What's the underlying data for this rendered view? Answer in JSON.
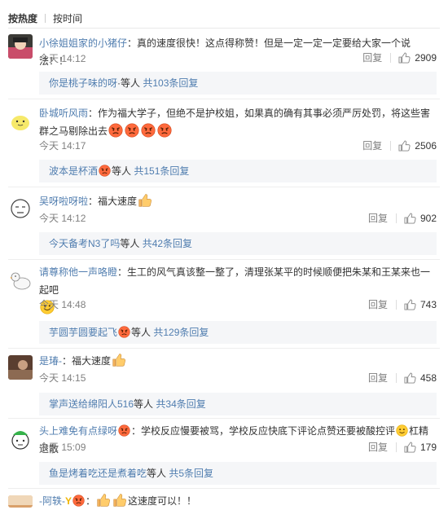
{
  "sort": {
    "hot": "按热度",
    "time": "按时间"
  },
  "comments": [
    {
      "user": "小徐姐姐家的小猪仔",
      "text": "：真的速度很快！这点得称赞！但是一定一定一定要给大家一个说法！！",
      "time": "今天 14:12",
      "reply_label": "回复",
      "likes": "2909",
      "reply_user": "你是桃子味的呀",
      "reply_etc": "·等人",
      "reply_count": "共103条回复"
    },
    {
      "user": "卧城听风雨",
      "text": "：作为福大学子，但绝不是护校姐，如果真的确有其事必须严厉处罚，将这些害群之马剔除出去",
      "time": "今天 14:17",
      "reply_label": "回复",
      "likes": "2506",
      "reply_user": "波本是杯酒",
      "reply_etc": "等人",
      "reply_count": "共151条回复"
    },
    {
      "user": "吴呀啦呀啦",
      "text": "：福大速度",
      "time": "今天 14:12",
      "reply_label": "回复",
      "likes": "902",
      "reply_user": "今天备考N3了吗",
      "reply_etc": "等人",
      "reply_count": "共42条回复"
    },
    {
      "user": "请尊称他一声咯瞪",
      "text": "：生工的风气真该整一整了，清理张某平的时候顺便把朱某和王某来也一起吧",
      "time": "今天 14:48",
      "reply_label": "回复",
      "likes": "743",
      "reply_user": "芋圆芋圆要起飞",
      "reply_etc": "等人",
      "reply_count": "共129条回复"
    },
    {
      "user": "是瑃-",
      "text": "：福大速度",
      "time": "今天 14:15",
      "reply_label": "回复",
      "likes": "458",
      "reply_user": "掌声送给绵阳人516",
      "reply_etc": "等人",
      "reply_count": "共34条回复"
    },
    {
      "user": "头上难免有点绿呀",
      "text": "：学校反应慢要被骂，学校反应快底下评论点赞还要被酸控评",
      "text2": "杠精退散",
      "time": "今天 15:09",
      "reply_label": "回复",
      "likes": "179",
      "reply_user": "鱼是烤着吃还是煮着吃",
      "reply_etc": "等人",
      "reply_count": "共5条回复"
    },
    {
      "user": "-阿轶-",
      "text": "这速度可以！！"
    }
  ],
  "colors": {
    "user": "#eb7350",
    "link": "#507daf",
    "muted": "#808080",
    "replybox": "#f5f6f8"
  }
}
